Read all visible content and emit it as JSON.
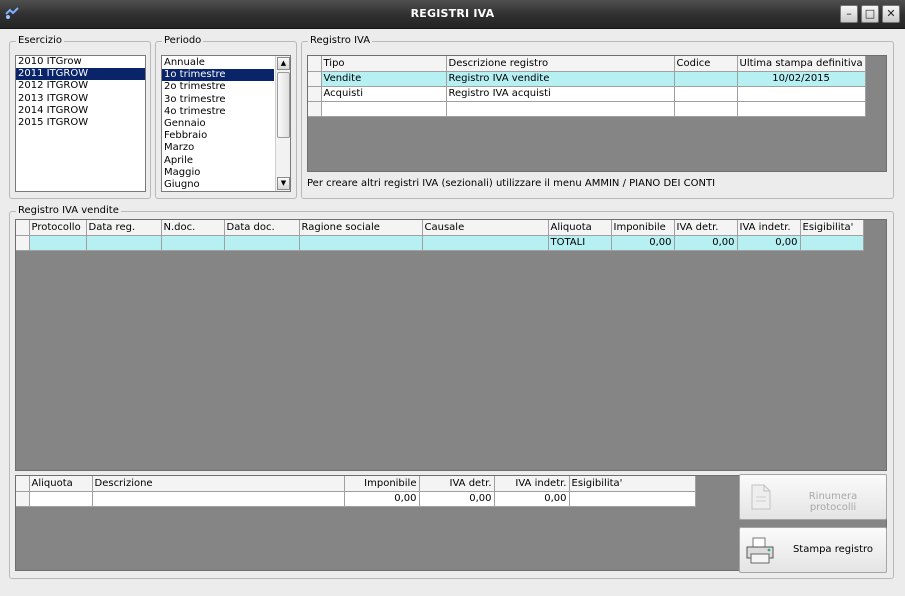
{
  "window": {
    "title": "REGISTRI IVA",
    "icon": "app-icon",
    "controls": [
      "minimize-icon",
      "maximize-icon",
      "close-icon"
    ]
  },
  "esercizio": {
    "title": "Esercizio",
    "items": [
      "2010 ITGrow",
      "2011 ITGROW",
      "2012 ITGROW",
      "2013 ITGROW",
      "2014 ITGROW",
      "2015 ITGROW"
    ],
    "selected_index": 1
  },
  "periodo": {
    "title": "Periodo",
    "items": [
      "Annuale",
      "1o trimestre",
      "2o trimestre",
      "3o trimestre",
      "4o trimestre",
      "Gennaio",
      "Febbraio",
      "Marzo",
      "Aprile",
      "Maggio",
      "Giugno"
    ],
    "selected_index": 1
  },
  "registro": {
    "title": "Registro IVA",
    "headers": [
      "Tipo",
      "Descrizione registro",
      "Codice",
      "Ultima stampa definitiva"
    ],
    "rows": [
      [
        "Vendite",
        "Registro IVA vendite",
        "",
        "10/02/2015"
      ],
      [
        "Acquisti",
        "Registro IVA acquisti",
        "",
        ""
      ],
      [
        "",
        "",
        "",
        ""
      ]
    ],
    "info": "Per creare altri registri IVA (sezionali) utilizzare il menu AMMIN / PIANO DEI CONTI"
  },
  "vendite": {
    "title": "Registro IVA vendite",
    "headers": [
      "Protocollo",
      "Data reg.",
      "N.doc.",
      "Data doc.",
      "Ragione sociale",
      "Causale",
      "Aliquota",
      "Imponibile",
      "IVA detr.",
      "IVA indetr.",
      "Esigibilita'"
    ],
    "totals": [
      "",
      "",
      "",
      "",
      "",
      "",
      "TOTALI",
      "0,00",
      "0,00",
      "0,00",
      ""
    ]
  },
  "riepilogo": {
    "headers": [
      "Aliquota",
      "Descrizione",
      "Imponibile",
      "IVA detr.",
      "IVA indetr.",
      "Esigibilita'"
    ],
    "totals": [
      "",
      "",
      "0,00",
      "0,00",
      "0,00",
      ""
    ]
  },
  "buttons": {
    "rinumera": "Rinumera protocolli",
    "stampa": "Stampa registro"
  },
  "colors": {
    "selection": "#0a246a",
    "row_highlight": "#b6f0f2",
    "grid_background": "#858585"
  }
}
